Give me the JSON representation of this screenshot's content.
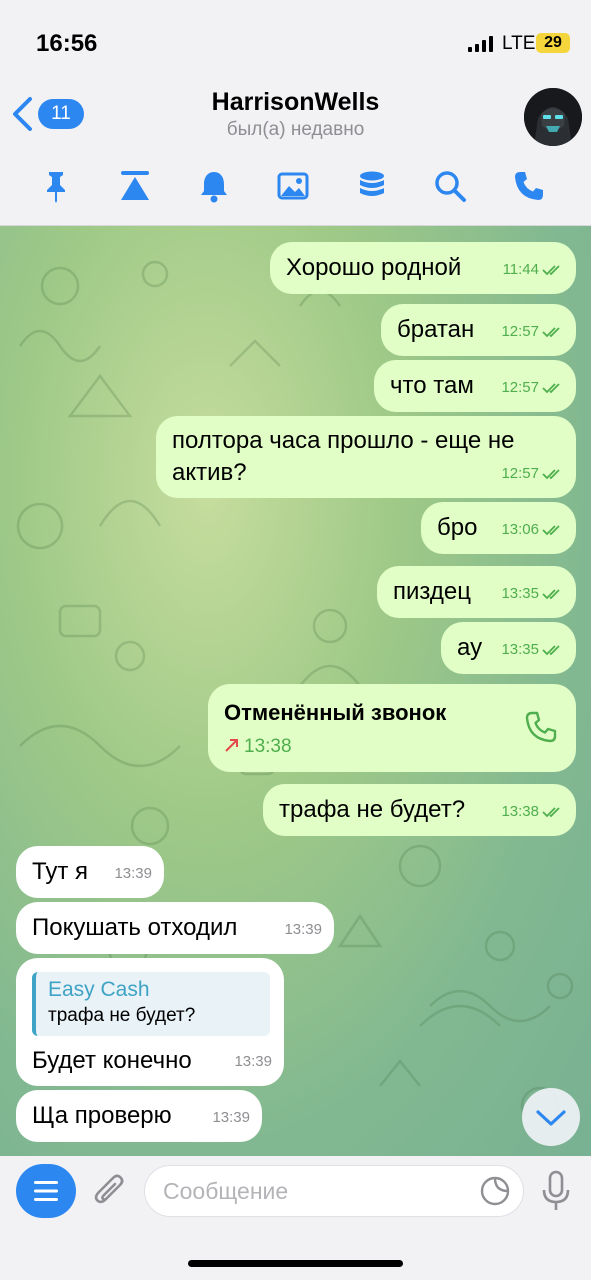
{
  "status": {
    "time": "16:56",
    "network": "LTE",
    "battery": "29"
  },
  "header": {
    "back_count": "11",
    "name": "HarrisonWells",
    "last_seen": "был(а) недавно",
    "toolbar_icons": [
      "pin-icon",
      "scroll-to-top-icon",
      "bell-icon",
      "image-icon",
      "database-icon",
      "search-icon",
      "phone-icon"
    ]
  },
  "messages": [
    {
      "dir": "out",
      "text": "Хорошо родной",
      "time": "11:44",
      "read": true
    },
    {
      "dir": "out",
      "text": "братан",
      "time": "12:57",
      "read": true
    },
    {
      "dir": "out",
      "text": "что там",
      "time": "12:57",
      "read": true
    },
    {
      "dir": "out",
      "text": "полтора часа прошло - еще не актив?",
      "time": "12:57",
      "read": true
    },
    {
      "dir": "out",
      "text": "бро",
      "time": "13:06",
      "read": true
    },
    {
      "dir": "out",
      "text": "пиздец",
      "time": "13:35",
      "read": true
    },
    {
      "dir": "out",
      "text": "ау",
      "time": "13:35",
      "read": true
    },
    {
      "dir": "out",
      "type": "call",
      "text": "Отменённый звонок",
      "time": "13:38"
    },
    {
      "dir": "out",
      "text": "трафа не будет?",
      "time": "13:38",
      "read": true
    },
    {
      "dir": "in",
      "text": "Тут я",
      "time": "13:39"
    },
    {
      "dir": "in",
      "text": "Покушать отходил",
      "time": "13:39"
    },
    {
      "dir": "in",
      "text": "Будет конечно",
      "time": "13:39",
      "reply": {
        "name": "Easy Cash",
        "text": "трафа не будет?"
      }
    },
    {
      "dir": "in",
      "text": "Ща проверю",
      "time": "13:39"
    }
  ],
  "input": {
    "placeholder": "Сообщение"
  },
  "colors": {
    "accent": "#2d87f0",
    "outgoing": "#e1fec6",
    "incoming": "#ffffff",
    "time_out": "#4fae4e",
    "reply_accent": "#3fa3c5"
  }
}
